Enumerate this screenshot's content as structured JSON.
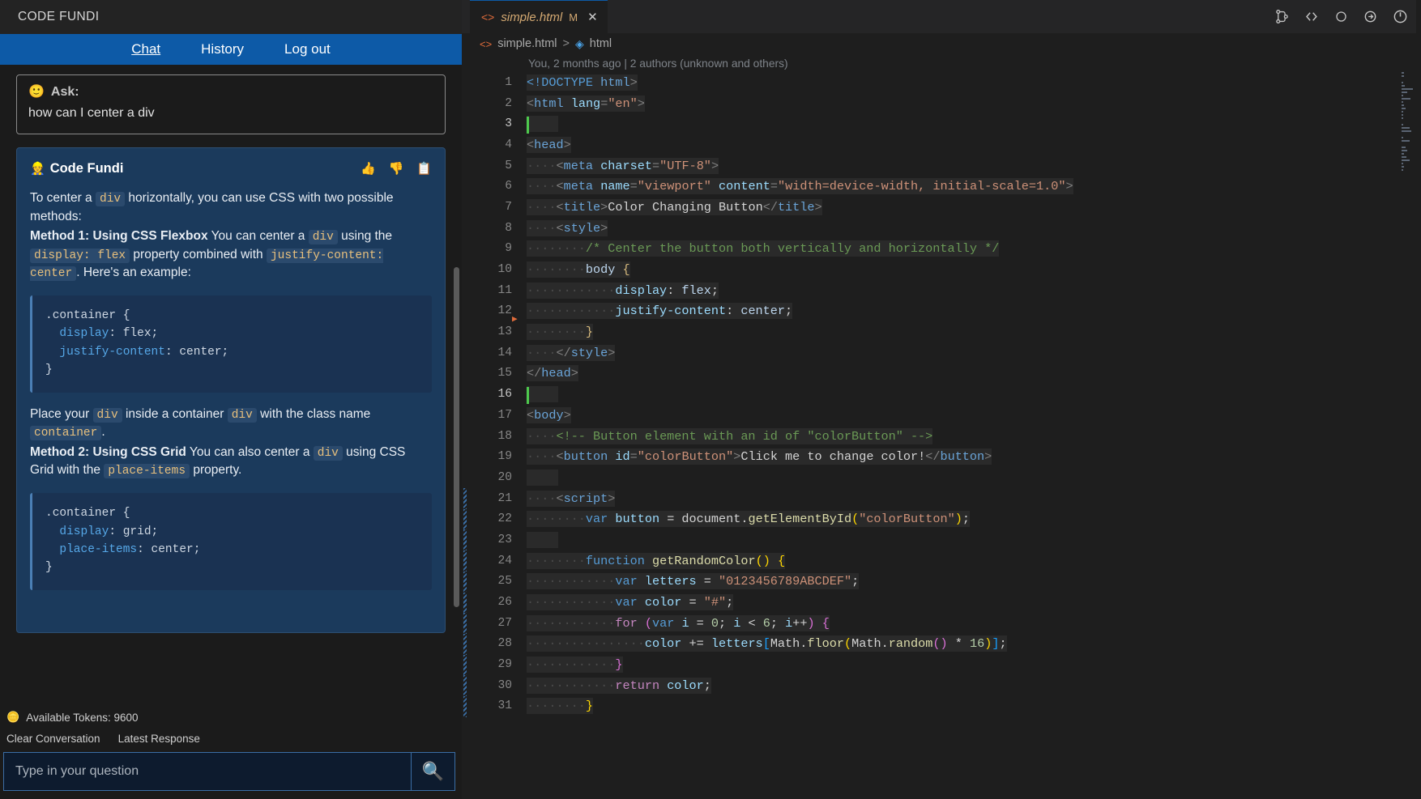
{
  "chat": {
    "brand": "CODE FUNDI",
    "nav": [
      {
        "label": "Chat",
        "active": true
      },
      {
        "label": "History",
        "active": false
      },
      {
        "label": "Log out",
        "active": false
      }
    ],
    "ask": {
      "emoji": "🙂",
      "label": "Ask:",
      "text": "how can I center a div"
    },
    "response": {
      "emoji": "👷",
      "name": "Code Fundi",
      "actions": [
        {
          "name": "thumbs-up",
          "glyph": "👍"
        },
        {
          "name": "thumbs-down",
          "glyph": "👎"
        },
        {
          "name": "copy",
          "glyph": "📋"
        }
      ],
      "p1_a": "To center a ",
      "p1_code1": "div",
      "p1_b": " horizontally, you can use CSS with two possible methods:",
      "p2_bold": "Method 1: Using CSS Flexbox",
      "p2_a": " You can center a ",
      "p2_code1": "div",
      "p2_b": " using the ",
      "p2_code2": "display: flex",
      "p2_c": " property combined with ",
      "p2_code3": "justify-content: center",
      "p2_d": ". Here's an example:",
      "code1_sel": ".container {",
      "code1_prop1": "display",
      "code1_val1": ": flex;",
      "code1_prop2": "justify-content",
      "code1_val2": ": center;",
      "code1_close": "}",
      "p3_a": "Place your ",
      "p3_code1": "div",
      "p3_b": " inside a container ",
      "p3_code2": "div",
      "p3_c": " with the class name ",
      "p3_code3": "container",
      "p3_d": ".",
      "p4_bold": "Method 2: Using CSS Grid",
      "p4_a": " You can also center a ",
      "p4_code1": "div",
      "p4_b": " using CSS Grid with the ",
      "p4_code2": "place-items",
      "p4_c": " property.",
      "code2_sel": ".container {",
      "code2_prop1": "display",
      "code2_val1": ": grid;",
      "code2_prop2": "place-items",
      "code2_val2": ": center;",
      "code2_close": "}"
    },
    "footer": {
      "tokens_icon": "🪙",
      "tokens_label": "Available Tokens: 9600",
      "clear_conversation": "Clear Conversation",
      "latest_response": "Latest Response",
      "input_placeholder": "Type in your question",
      "input_value": "",
      "search_icon": "🔍"
    }
  },
  "editor": {
    "tab": {
      "code_icon": "<>",
      "filename": "simple.html",
      "modified_badge": "M",
      "close": "✕"
    },
    "toolbar_icons": [
      {
        "name": "source-control-icon"
      },
      {
        "name": "go-back-icon"
      },
      {
        "name": "circle-outline-icon"
      },
      {
        "name": "arrow-right-circle-icon"
      },
      {
        "name": "power-icon"
      }
    ],
    "breadcrumb": {
      "code_icon": "<>",
      "file": "simple.html",
      "separator": ">",
      "cube_icon": "◈",
      "symbol": "html"
    },
    "blame": "You, 2 months ago | 2 authors (unknown and others)",
    "lines": [
      {
        "n": 1,
        "tokens": [
          {
            "t": "doctype",
            "v": "<!DOCTYPE "
          },
          {
            "t": "tag",
            "v": "html"
          },
          {
            "t": "punct",
            "v": ">"
          }
        ]
      },
      {
        "n": 2,
        "tokens": [
          {
            "t": "punct",
            "v": "<"
          },
          {
            "t": "tag",
            "v": "html"
          },
          {
            "t": "plain",
            "v": " "
          },
          {
            "t": "attr",
            "v": "lang"
          },
          {
            "t": "punct",
            "v": "="
          },
          {
            "t": "str",
            "v": "\"en\""
          },
          {
            "t": "punct",
            "v": ">"
          }
        ]
      },
      {
        "n": 3,
        "tokens": [],
        "cursor": true
      },
      {
        "n": 4,
        "tokens": [
          {
            "t": "punct",
            "v": "<"
          },
          {
            "t": "tag",
            "v": "head"
          },
          {
            "t": "punct",
            "v": ">"
          }
        ]
      },
      {
        "n": 5,
        "indent": 4,
        "tokens": [
          {
            "t": "punct",
            "v": "<"
          },
          {
            "t": "tag",
            "v": "meta"
          },
          {
            "t": "plain",
            "v": " "
          },
          {
            "t": "attr",
            "v": "charset"
          },
          {
            "t": "punct",
            "v": "="
          },
          {
            "t": "str",
            "v": "\"UTF-8\""
          },
          {
            "t": "punct",
            "v": ">"
          }
        ]
      },
      {
        "n": 6,
        "indent": 4,
        "tokens": [
          {
            "t": "punct",
            "v": "<"
          },
          {
            "t": "tag",
            "v": "meta"
          },
          {
            "t": "plain",
            "v": " "
          },
          {
            "t": "attr",
            "v": "name"
          },
          {
            "t": "punct",
            "v": "="
          },
          {
            "t": "str",
            "v": "\"viewport\""
          },
          {
            "t": "plain",
            "v": " "
          },
          {
            "t": "attr",
            "v": "content"
          },
          {
            "t": "punct",
            "v": "="
          },
          {
            "t": "str",
            "v": "\"width=device-width, initial-scale=1.0\""
          },
          {
            "t": "punct",
            "v": ">"
          }
        ]
      },
      {
        "n": 7,
        "indent": 4,
        "tokens": [
          {
            "t": "punct",
            "v": "<"
          },
          {
            "t": "tag",
            "v": "title"
          },
          {
            "t": "punct",
            "v": ">"
          },
          {
            "t": "plain",
            "v": "Color Changing Button"
          },
          {
            "t": "punct",
            "v": "</"
          },
          {
            "t": "tag",
            "v": "title"
          },
          {
            "t": "punct",
            "v": ">"
          }
        ]
      },
      {
        "n": 8,
        "indent": 4,
        "tokens": [
          {
            "t": "punct",
            "v": "<"
          },
          {
            "t": "tag",
            "v": "style"
          },
          {
            "t": "punct",
            "v": ">"
          }
        ]
      },
      {
        "n": 9,
        "indent": 8,
        "tokens": [
          {
            "t": "com",
            "v": "/* Center the button both vertically and horizontally */"
          }
        ]
      },
      {
        "n": 10,
        "indent": 8,
        "tokens": [
          {
            "t": "val",
            "v": "body"
          },
          {
            "t": "plain",
            "v": " "
          },
          {
            "t": "brace",
            "v": "{"
          }
        ]
      },
      {
        "n": 11,
        "indent": 12,
        "tokens": [
          {
            "t": "prop",
            "v": "display"
          },
          {
            "t": "plain",
            "v": ": "
          },
          {
            "t": "val",
            "v": "flex"
          },
          {
            "t": "plain",
            "v": ";"
          }
        ]
      },
      {
        "n": 12,
        "indent": 12,
        "tokens": [
          {
            "t": "prop",
            "v": "justify-content"
          },
          {
            "t": "plain",
            "v": ": "
          },
          {
            "t": "val",
            "v": "center"
          },
          {
            "t": "plain",
            "v": ";"
          }
        ],
        "fold": true
      },
      {
        "n": 13,
        "indent": 8,
        "tokens": [
          {
            "t": "brace",
            "v": "}"
          }
        ]
      },
      {
        "n": 14,
        "indent": 4,
        "tokens": [
          {
            "t": "punct",
            "v": "</"
          },
          {
            "t": "tag",
            "v": "style"
          },
          {
            "t": "punct",
            "v": ">"
          }
        ]
      },
      {
        "n": 15,
        "tokens": [
          {
            "t": "punct",
            "v": "</"
          },
          {
            "t": "tag",
            "v": "head"
          },
          {
            "t": "punct",
            "v": ">"
          }
        ]
      },
      {
        "n": 16,
        "tokens": [],
        "cursor": true
      },
      {
        "n": 17,
        "tokens": [
          {
            "t": "punct",
            "v": "<"
          },
          {
            "t": "tag",
            "v": "body"
          },
          {
            "t": "punct",
            "v": ">"
          }
        ]
      },
      {
        "n": 18,
        "indent": 4,
        "tokens": [
          {
            "t": "com",
            "v": "<!-- Button element with an id of \"colorButton\" -->"
          }
        ]
      },
      {
        "n": 19,
        "indent": 4,
        "tokens": [
          {
            "t": "punct",
            "v": "<"
          },
          {
            "t": "tag",
            "v": "button"
          },
          {
            "t": "plain",
            "v": " "
          },
          {
            "t": "attr",
            "v": "id"
          },
          {
            "t": "punct",
            "v": "="
          },
          {
            "t": "str",
            "v": "\"colorButton\""
          },
          {
            "t": "punct",
            "v": ">"
          },
          {
            "t": "plain",
            "v": "Click me to change color!"
          },
          {
            "t": "punct",
            "v": "</"
          },
          {
            "t": "tag",
            "v": "button"
          },
          {
            "t": "punct",
            "v": ">"
          }
        ]
      },
      {
        "n": 20,
        "tokens": []
      },
      {
        "n": 21,
        "indent": 4,
        "tokens": [
          {
            "t": "punct",
            "v": "<"
          },
          {
            "t": "tag",
            "v": "script"
          },
          {
            "t": "punct",
            "v": ">"
          }
        ],
        "diff": true
      },
      {
        "n": 22,
        "indent": 8,
        "tokens": [
          {
            "t": "kw",
            "v": "var"
          },
          {
            "t": "plain",
            "v": " "
          },
          {
            "t": "var",
            "v": "button"
          },
          {
            "t": "plain",
            "v": " = "
          },
          {
            "t": "plain",
            "v": "document"
          },
          {
            "t": "plain",
            "v": "."
          },
          {
            "t": "fn",
            "v": "getElementById"
          },
          {
            "t": "b1",
            "v": "("
          },
          {
            "t": "str",
            "v": "\"colorButton\""
          },
          {
            "t": "b1",
            "v": ")"
          },
          {
            "t": "plain",
            "v": ";"
          }
        ],
        "diff": true
      },
      {
        "n": 23,
        "tokens": [],
        "diff": true
      },
      {
        "n": 24,
        "indent": 8,
        "tokens": [
          {
            "t": "kw",
            "v": "function"
          },
          {
            "t": "plain",
            "v": " "
          },
          {
            "t": "fn",
            "v": "getRandomColor"
          },
          {
            "t": "b1",
            "v": "()"
          },
          {
            "t": "plain",
            "v": " "
          },
          {
            "t": "b1",
            "v": "{"
          }
        ],
        "diff": true
      },
      {
        "n": 25,
        "indent": 12,
        "tokens": [
          {
            "t": "kw",
            "v": "var"
          },
          {
            "t": "plain",
            "v": " "
          },
          {
            "t": "var",
            "v": "letters"
          },
          {
            "t": "plain",
            "v": " = "
          },
          {
            "t": "str",
            "v": "\"0123456789ABCDEF\""
          },
          {
            "t": "plain",
            "v": ";"
          }
        ],
        "diff": true
      },
      {
        "n": 26,
        "indent": 12,
        "tokens": [
          {
            "t": "kw",
            "v": "var"
          },
          {
            "t": "plain",
            "v": " "
          },
          {
            "t": "var",
            "v": "color"
          },
          {
            "t": "plain",
            "v": " = "
          },
          {
            "t": "str",
            "v": "\"#\""
          },
          {
            "t": "plain",
            "v": ";"
          }
        ],
        "diff": true
      },
      {
        "n": 27,
        "indent": 12,
        "tokens": [
          {
            "t": "kw2",
            "v": "for"
          },
          {
            "t": "plain",
            "v": " "
          },
          {
            "t": "b2",
            "v": "("
          },
          {
            "t": "kw",
            "v": "var"
          },
          {
            "t": "plain",
            "v": " "
          },
          {
            "t": "var",
            "v": "i"
          },
          {
            "t": "plain",
            "v": " = "
          },
          {
            "t": "num",
            "v": "0"
          },
          {
            "t": "plain",
            "v": "; "
          },
          {
            "t": "var",
            "v": "i"
          },
          {
            "t": "plain",
            "v": " < "
          },
          {
            "t": "num",
            "v": "6"
          },
          {
            "t": "plain",
            "v": "; "
          },
          {
            "t": "var",
            "v": "i"
          },
          {
            "t": "plain",
            "v": "++"
          },
          {
            "t": "b2",
            "v": ")"
          },
          {
            "t": "plain",
            "v": " "
          },
          {
            "t": "b2",
            "v": "{"
          }
        ],
        "diff": true
      },
      {
        "n": 28,
        "indent": 16,
        "tokens": [
          {
            "t": "var",
            "v": "color"
          },
          {
            "t": "plain",
            "v": " += "
          },
          {
            "t": "var",
            "v": "letters"
          },
          {
            "t": "b3",
            "v": "["
          },
          {
            "t": "plain",
            "v": "Math"
          },
          {
            "t": "plain",
            "v": "."
          },
          {
            "t": "fn",
            "v": "floor"
          },
          {
            "t": "b1",
            "v": "("
          },
          {
            "t": "plain",
            "v": "Math"
          },
          {
            "t": "plain",
            "v": "."
          },
          {
            "t": "fn",
            "v": "random"
          },
          {
            "t": "b2",
            "v": "()"
          },
          {
            "t": "plain",
            "v": " * "
          },
          {
            "t": "num",
            "v": "16"
          },
          {
            "t": "b1",
            "v": ")"
          },
          {
            "t": "b3",
            "v": "]"
          },
          {
            "t": "plain",
            "v": ";"
          }
        ],
        "diff": true
      },
      {
        "n": 29,
        "indent": 12,
        "tokens": [
          {
            "t": "b2",
            "v": "}"
          }
        ],
        "diff": true
      },
      {
        "n": 30,
        "indent": 12,
        "tokens": [
          {
            "t": "kw2",
            "v": "return"
          },
          {
            "t": "plain",
            "v": " "
          },
          {
            "t": "var",
            "v": "color"
          },
          {
            "t": "plain",
            "v": ";"
          }
        ],
        "diff": true
      },
      {
        "n": 31,
        "indent": 8,
        "tokens": [
          {
            "t": "b1",
            "v": "}"
          }
        ],
        "diff": true
      }
    ]
  }
}
